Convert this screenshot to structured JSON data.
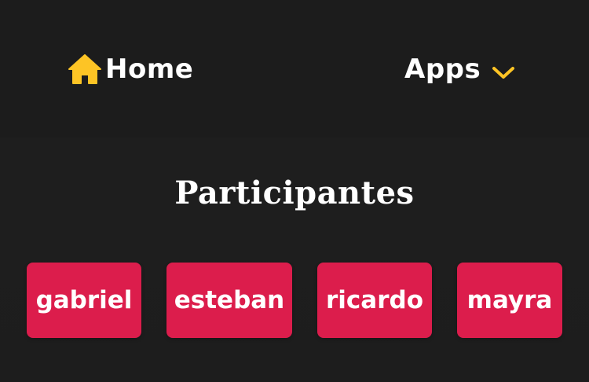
{
  "colors": {
    "background": "#1f1f1f",
    "navbar_background": "#1c1c1c",
    "accent_yellow": "#fdc425",
    "participant_button": "#dc1d4c",
    "text": "#ffffff"
  },
  "navbar": {
    "home_icon": "home-icon",
    "home_label": "Home",
    "apps_label": "Apps",
    "apps_icon": "chevron-down-icon"
  },
  "main": {
    "title": "Participantes",
    "participants": [
      "gabriel",
      "esteban",
      "ricardo",
      "mayra"
    ]
  }
}
